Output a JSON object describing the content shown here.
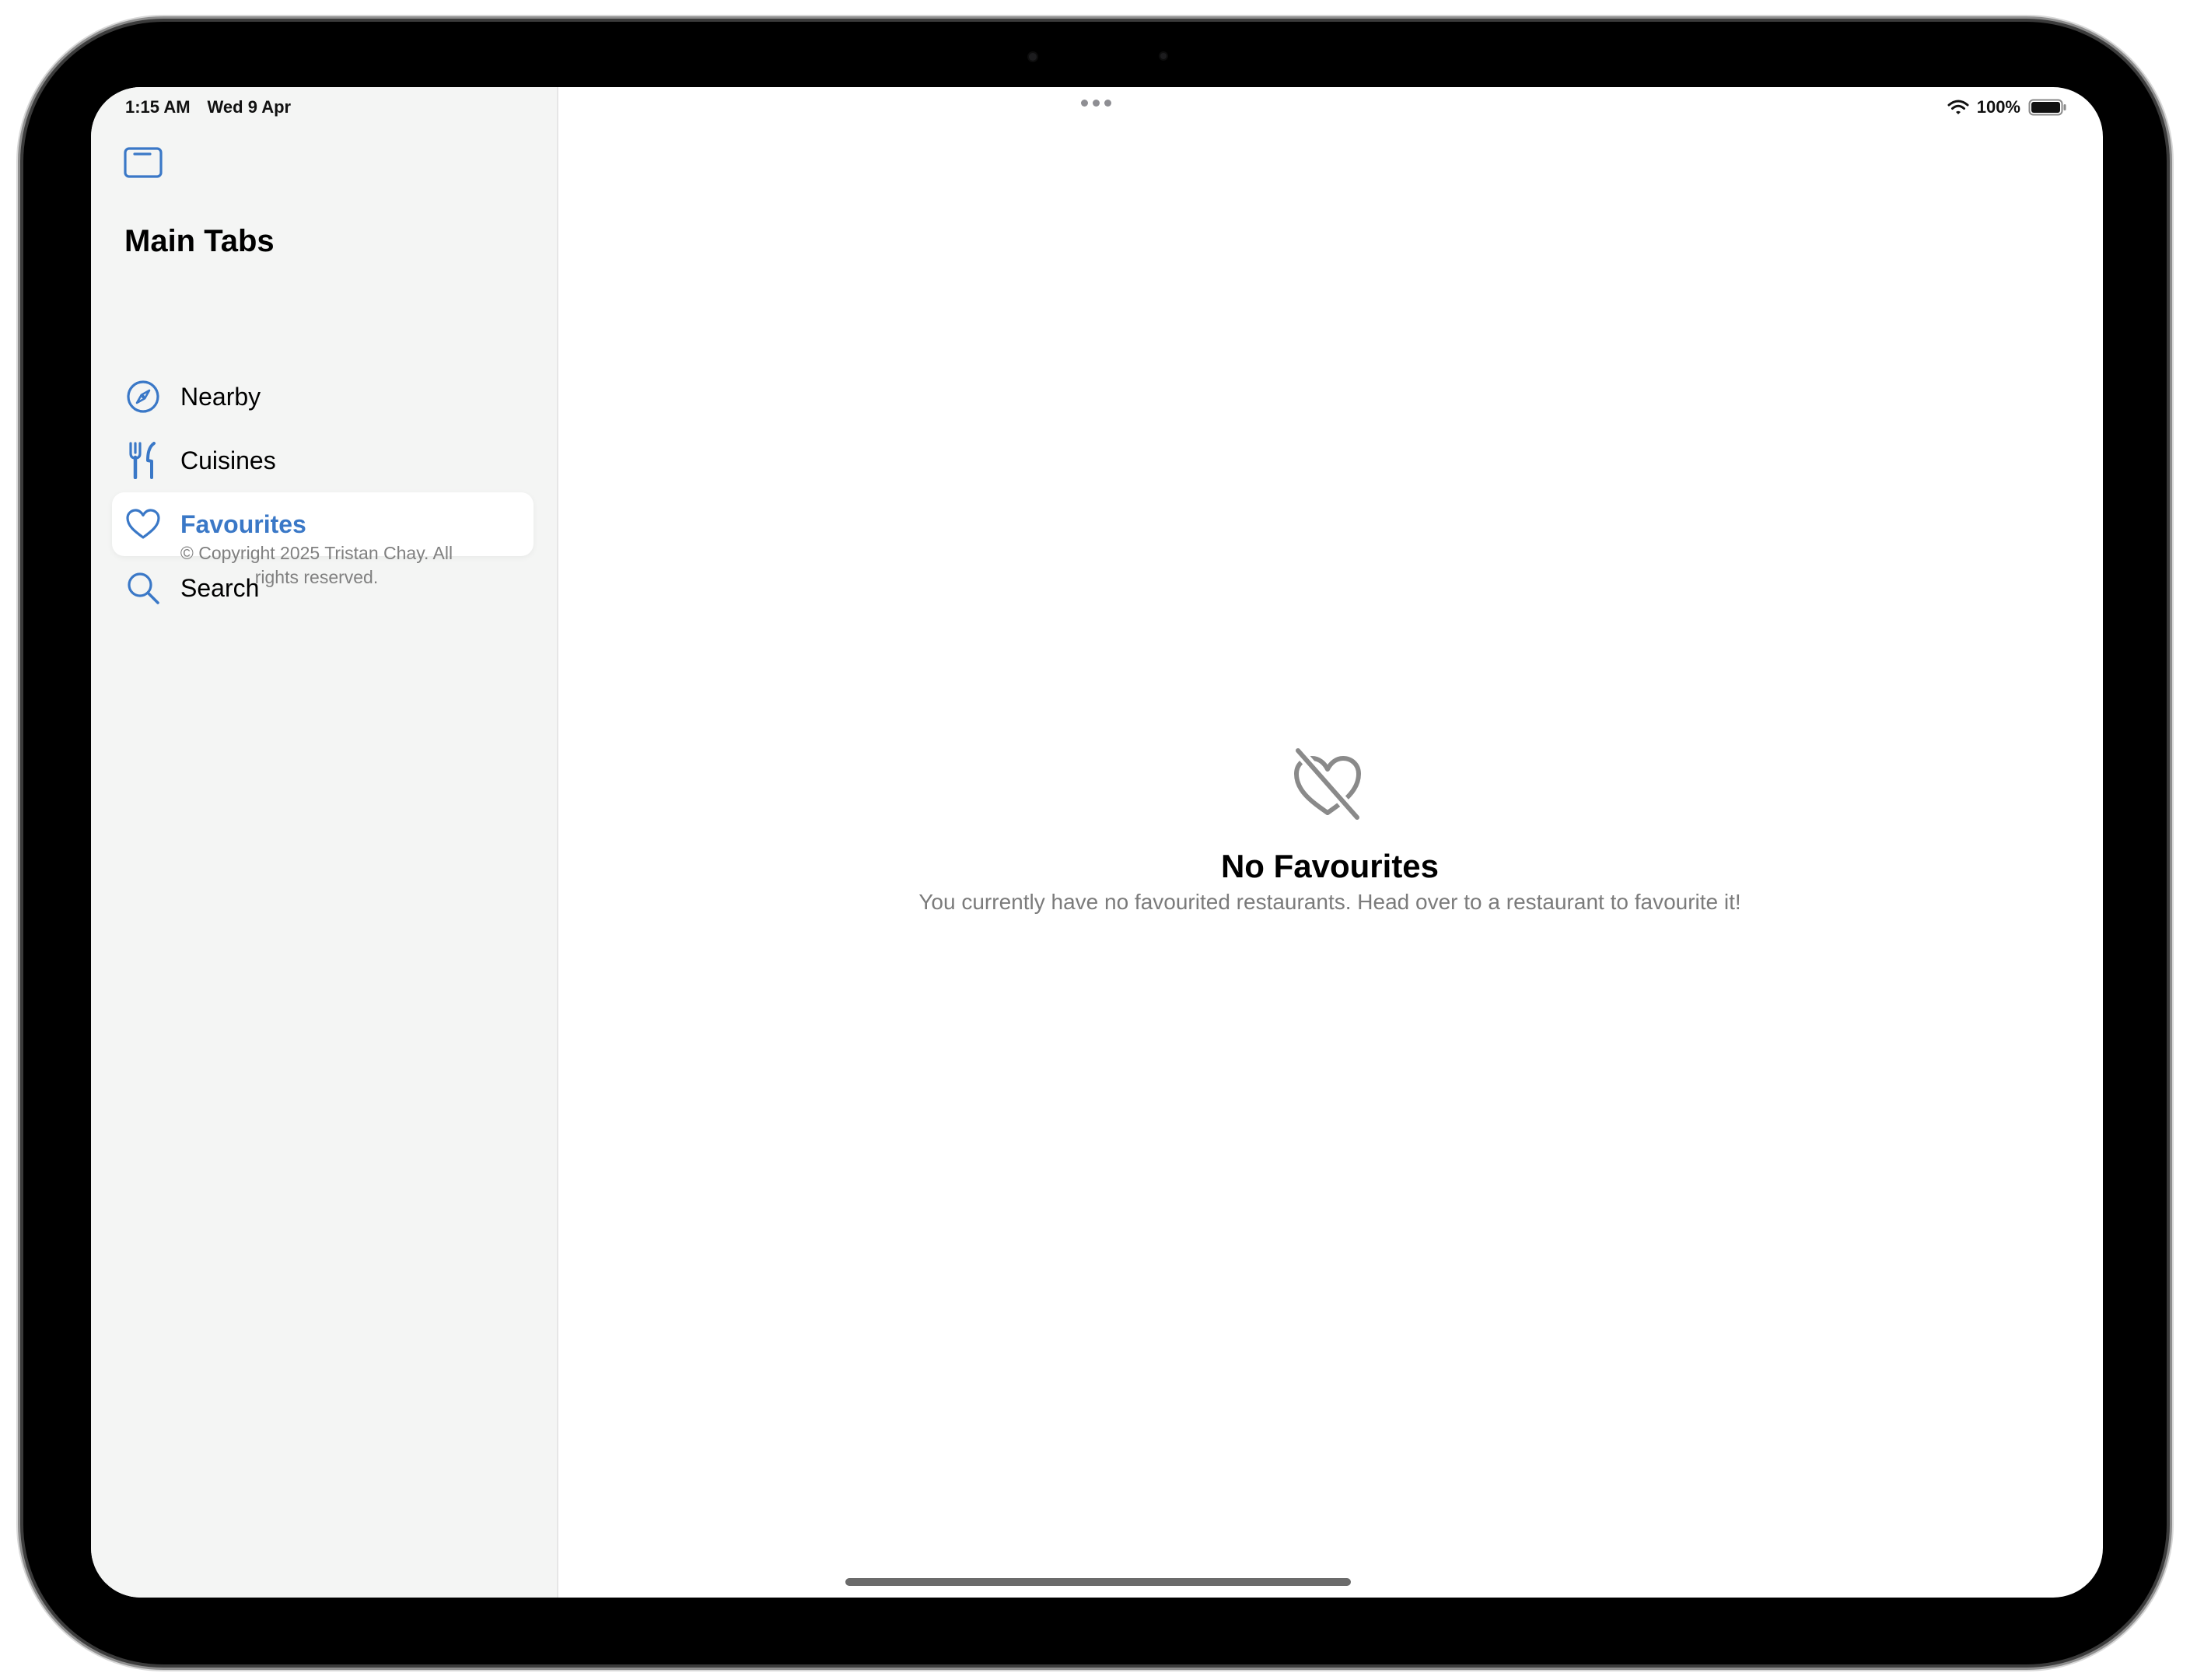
{
  "status_bar": {
    "time": "1:15 AM",
    "date": "Wed 9 Apr",
    "battery": "100%"
  },
  "sidebar": {
    "section_title": "Main Tabs",
    "items": [
      {
        "label": "Nearby",
        "icon": "compass-icon",
        "selected": false
      },
      {
        "label": "Cuisines",
        "icon": "fork-knife-icon",
        "selected": false
      },
      {
        "label": "Favourites",
        "icon": "heart-icon",
        "selected": true
      },
      {
        "label": "Search",
        "icon": "magnifying-glass-icon",
        "selected": false
      }
    ],
    "copyright": "© Copyright 2025 Tristan Chay. All rights reserved."
  },
  "main": {
    "empty_state": {
      "icon": "heart-slash-icon",
      "title": "No Favourites",
      "message": "You currently have no favourited restaurants. Head over to a restaurant to favourite it!"
    }
  },
  "colors": {
    "accent": "#3a78c7",
    "sidebar_background": "#f4f5f4",
    "secondary_text": "#7b7b7b"
  }
}
